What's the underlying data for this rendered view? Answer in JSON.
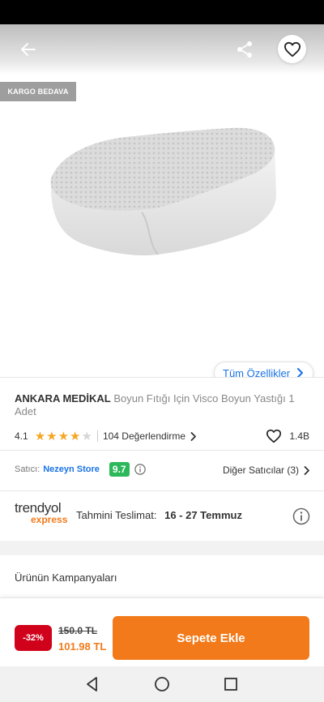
{
  "top_bar": {
    "back_icon": "arrow-left-icon",
    "share_icon": "share-icon",
    "favorite_icon": "heart-outline-icon"
  },
  "badge": {
    "label": "KARGO BEDAVA"
  },
  "all_features": {
    "label": "Tüm Özellikler",
    "icon": "chevron-right-icon"
  },
  "product": {
    "brand": "ANKARA MEDİKAL",
    "name": "Boyun Fıtığı Için Visco Boyun Yastığı 1 Adet",
    "rating": "4.1",
    "stars_filled": 4,
    "stars_total": 5,
    "review_count": "104 Değerlendirme",
    "like_count": "1.4B",
    "star_color": "#f5a623"
  },
  "seller": {
    "label": "Satıcı:",
    "name": "Nezeyn Store",
    "score": "9.7",
    "score_color": "#2eb85c",
    "other_sellers": "Diğer Satıcılar (3)"
  },
  "delivery": {
    "logo_line1": "trendyol",
    "logo_line2": "express",
    "label": "Tahmini Teslimat:",
    "dates": "16 - 27 Temmuz"
  },
  "campaigns": {
    "title": "Ürünün Kampanyaları"
  },
  "purchase": {
    "discount": "-32%",
    "old_price": "150.0 TL",
    "new_price": "101.98 TL",
    "add_to_cart": "Sepete Ekle",
    "accent": "#f27a1a",
    "discount_color": "#d0021b"
  },
  "system_nav": {
    "back": "triangle-back-icon",
    "home": "circle-home-icon",
    "recents": "square-recents-icon"
  }
}
